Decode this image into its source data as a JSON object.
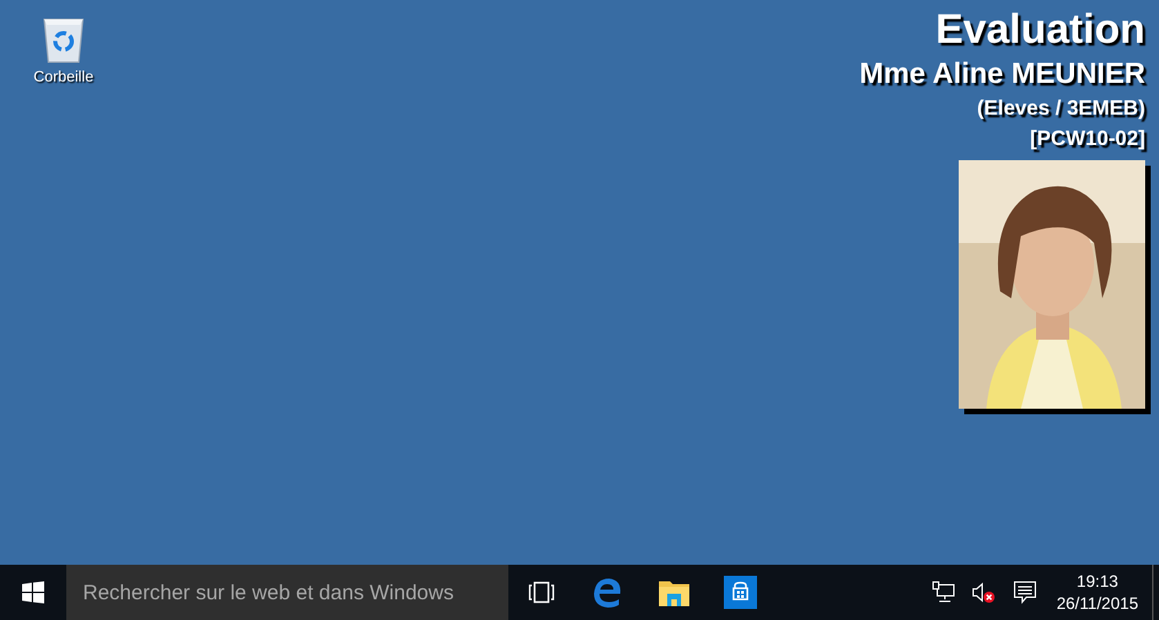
{
  "desktop_icons": [
    {
      "label": "Corbeille"
    }
  ],
  "info": {
    "title": "Evaluation",
    "user": "Mme Aline MEUNIER",
    "group": "(Eleves / 3EMEB)",
    "computer": "[PCW10-02]"
  },
  "taskbar": {
    "search": {
      "placeholder": "Rechercher sur le web et dans Windows"
    },
    "volume": {
      "muted": true
    },
    "clock": {
      "time": "19:13",
      "date": "26/11/2015"
    }
  }
}
